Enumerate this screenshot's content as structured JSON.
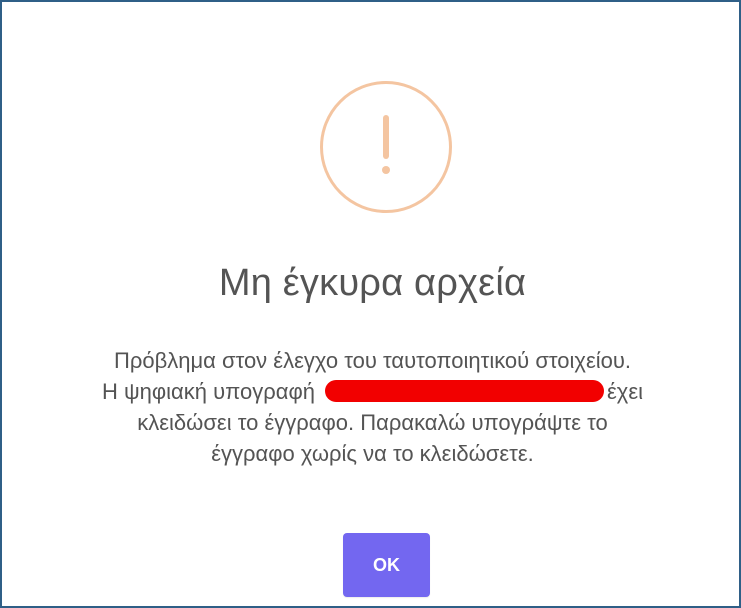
{
  "dialog": {
    "icon": "warning-icon",
    "title": "Μη έγκυρα αρχεία",
    "message_lines": [
      "Πρόβλημα στον έλεγχο του ταυτοποιητικού στοιχείου.",
      "Η ψηφιακή υπογραφή",
      "έχει",
      "κλειδώσει το έγγραφο. Παρακαλώ υπογράψτε το",
      "έγγραφο χωρίς να το κλειδώσετε."
    ],
    "button_label": "OK",
    "colors": {
      "border": "#2f5f87",
      "icon": "#f4c5a1",
      "text": "#545454",
      "button": "#7367f0",
      "redaction": "#f20000"
    }
  }
}
